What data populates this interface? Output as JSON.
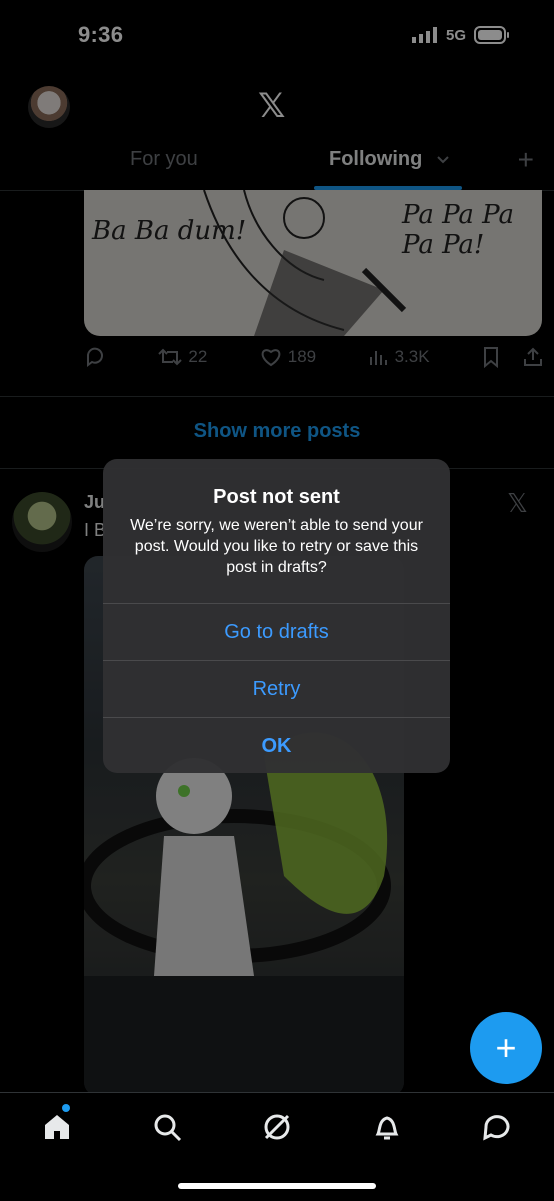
{
  "status_bar": {
    "time": "9:36",
    "network": "5G"
  },
  "header": {
    "tabs": [
      {
        "label": "For you"
      },
      {
        "label": "Following"
      }
    ]
  },
  "post1": {
    "image_text": {
      "left": "Ba Ba dum!",
      "right": "Pa Pa Pa Pa Pa!"
    },
    "actions": {
      "retweets": "22",
      "likes": "189",
      "views": "3.3K"
    }
  },
  "feed": {
    "show_more_label": "Show more posts"
  },
  "post2": {
    "name_visible": "Ju",
    "text_visible": "I B"
  },
  "alert": {
    "title": "Post not sent",
    "message": "We’re sorry, we weren’t able to send your post. Would you like to retry or save this post in drafts?",
    "buttons": {
      "drafts": "Go to drafts",
      "retry": "Retry",
      "ok": "OK"
    }
  },
  "colors": {
    "accent": "#1d9bf0",
    "alert_button": "#3c9bff"
  },
  "icons": [
    "x-logo-icon",
    "plus-icon",
    "reply-icon",
    "retweet-icon",
    "like-icon",
    "views-icon",
    "bookmark-icon",
    "share-icon",
    "home-icon",
    "search-icon",
    "grok-icon",
    "notifications-icon",
    "messages-icon"
  ]
}
